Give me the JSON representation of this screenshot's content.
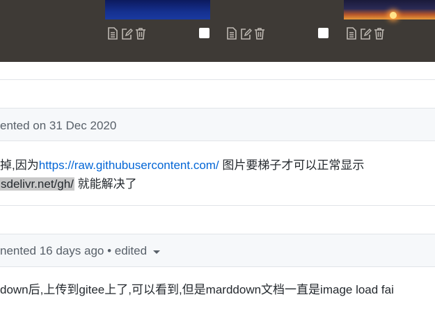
{
  "colors": {
    "band": "#3e3a36",
    "link": "#0366d6",
    "meta_text": "#586069",
    "header_bg": "#f6f8fa"
  },
  "toolbar_icons": [
    "file-icon",
    "edit-icon",
    "trash-icon"
  ],
  "comment1": {
    "meta": "ented on 31 Dec 2020",
    "line1_prefix": "掉,因为",
    "line1_link": "https://raw.githubusercontent.com/",
    "line1_suffix": " 图片要梯子才可以正常显示",
    "line2_code": "sdelivr.net/gh/",
    "line2_suffix": " 就能解决了"
  },
  "comment2": {
    "meta": "nented 16 days ago • edited",
    "body": "down后,上传到gitee上了,可以看到,但是marddown文档一直是image load fai"
  }
}
